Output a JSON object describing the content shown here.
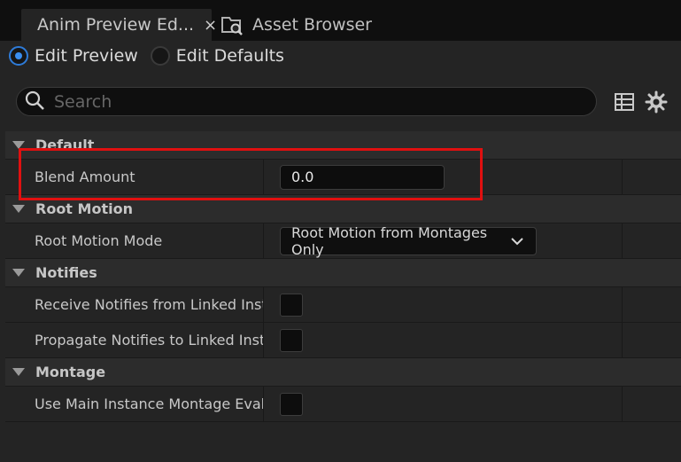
{
  "tabs": {
    "active_label": "Anim Preview Ed...",
    "close_glyph": "×",
    "inactive_label": "Asset Browser",
    "inactive_icon": "asset-browser-icon"
  },
  "mode": {
    "edit_preview": "Edit Preview",
    "edit_defaults": "Edit Defaults",
    "selected": "edit_preview"
  },
  "search": {
    "placeholder": "Search"
  },
  "toolbar": {
    "icons": [
      "table-view-icon",
      "settings-gear-icon"
    ]
  },
  "categories": {
    "default": {
      "label": "Default",
      "rows": [
        {
          "name": "Blend Amount",
          "value": "0.0"
        }
      ]
    },
    "root_motion": {
      "label": "Root Motion",
      "rows": [
        {
          "name": "Root Motion Mode",
          "value": "Root Motion from Montages Only"
        }
      ]
    },
    "notifies": {
      "label": "Notifies",
      "rows": [
        {
          "name": "Receive Notifies from Linked Insta...",
          "checked": false
        },
        {
          "name": "Propagate Notifies to Linked Insta...",
          "checked": false
        }
      ]
    },
    "montage": {
      "label": "Montage",
      "rows": [
        {
          "name": "Use Main Instance Montage Evalu...",
          "checked": false
        }
      ]
    }
  },
  "colors": {
    "highlight": "#e01010",
    "accent": "#3a8ef0",
    "panel": "#242424"
  }
}
